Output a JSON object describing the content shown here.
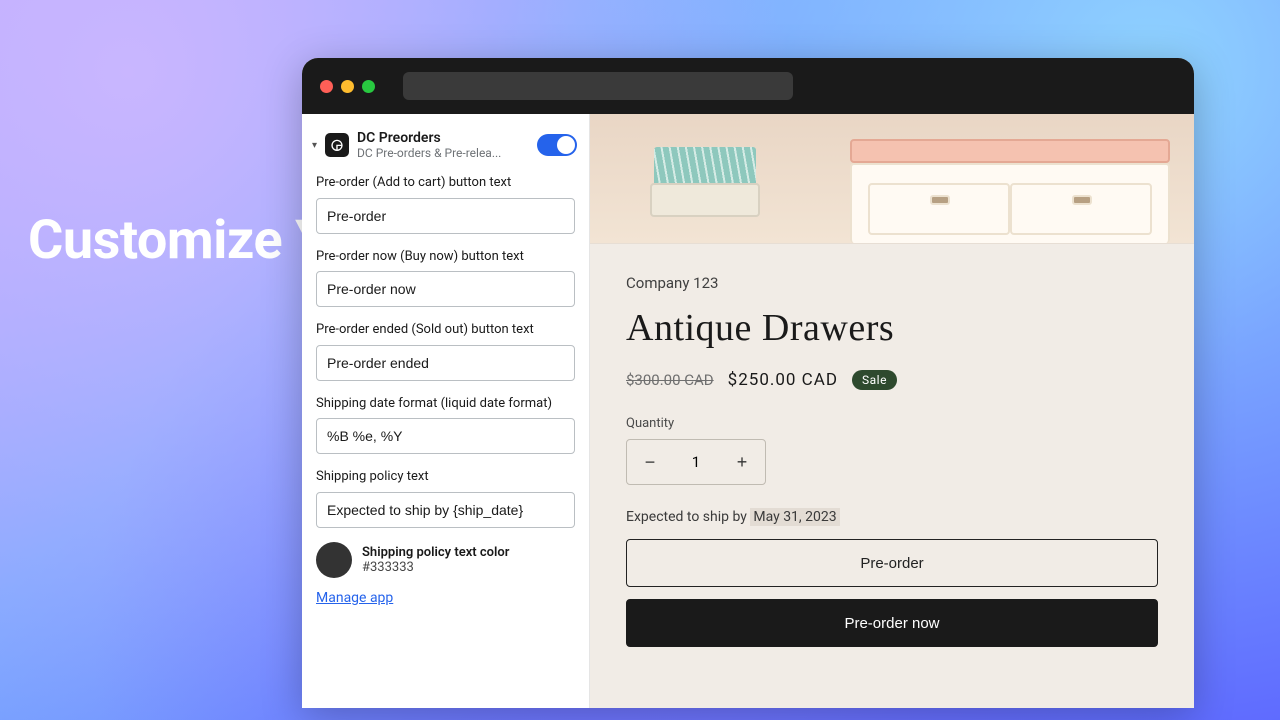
{
  "headline": "Customize Your Preorder Settings with Ease",
  "sidebar": {
    "app_title": "DC Preorders",
    "app_subtitle": "DC Pre-orders & Pre-relea...",
    "toggle_on": true,
    "fields": {
      "add_to_cart": {
        "label": "Pre-order (Add to cart) button text",
        "value": "Pre-order"
      },
      "buy_now": {
        "label": "Pre-order now (Buy now) button text",
        "value": "Pre-order now"
      },
      "sold_out": {
        "label": "Pre-order ended (Sold out) button text",
        "value": "Pre-order ended"
      },
      "date_format": {
        "label": "Shipping date format (liquid date format)",
        "value": "%B %e, %Y"
      },
      "policy_text": {
        "label": "Shipping policy text",
        "value": "Expected to ship by {ship_date}"
      }
    },
    "color": {
      "label": "Shipping policy text color",
      "value": "#333333"
    },
    "manage_link": "Manage app"
  },
  "preview": {
    "vendor": "Company 123",
    "title": "Antique Drawers",
    "price_old": "$300.00 CAD",
    "price_now": "$250.00 CAD",
    "sale_badge": "Sale",
    "quantity_label": "Quantity",
    "quantity_value": "1",
    "ship_prefix": "Expected to ship by ",
    "ship_date": "May 31, 2023",
    "btn_outline": "Pre-order",
    "btn_solid": "Pre-order now"
  }
}
